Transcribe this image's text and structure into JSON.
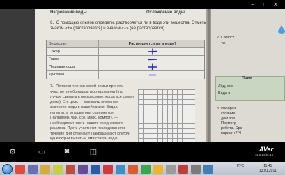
{
  "window": {
    "minimize_glyph": "−",
    "maximize_glyph": "□",
    "close_glyph": "✕"
  },
  "book_left": {
    "header_left": "Нагревание воды",
    "header_right": "Охлаждение воды",
    "task6_number": "6.",
    "task6_text": "С помощью опытов определи, растворяется ли в во­де эти вещества. Отметь знаком «+» (растворяется) и знаком «−» (не растворяется).",
    "table": {
      "col1": "Вещество",
      "col2": "Растворяется ли в воде?",
      "rows": [
        {
          "substance": "Сахар",
          "mark": "+"
        },
        {
          "substance": "Глина",
          "mark": "−"
        },
        {
          "substance": "Пищевая сода",
          "mark": "+"
        },
        {
          "substance": "Крахмал",
          "mark": "−"
        }
      ]
    },
    "task7_number": "7.",
    "task7_text": "Попроси членов своей семьи принять участие в небольшом исследовании (это лучше сделать в воскресенье, когда все семья дома). Его цель — осознать огром­ное значение воды в нашей жизни. Вода и напитки, в которых она со­держится (например, чай, сок, морс, ком­пот), — необходимая часть нашего еже­дневного рациона. Пусть участники исследования в тече­ние дня отмечают (закрашивают клеточ­ку) каждый выпитый ими стакан воды. ...количество ..."
  },
  "book_right": {
    "item2": "2. Самост",
    "item2b": "ты",
    "box_label_1": "Прим",
    "box_label_2": "Лёд, сне",
    "box_label_3": "Вода в",
    "item3": "3. Изобраз",
    "item3_lines": [
      "стояние",
      "дом зов",
      "Посмотр",
      "ребята. Сра",
      "вариант? Ч"
    ]
  },
  "toolbar": {
    "settings_glyph": "⚙",
    "crop_glyph": "▭",
    "record_glyph": "◙",
    "photo_glyph": "◫",
    "brand": "AVer",
    "brand_sub": "11.0.2040.44"
  },
  "taskbar": {
    "language": "РУС",
    "time": "11:41",
    "date": "13.01.2011"
  },
  "colors": {
    "page": "#e9e6df",
    "ink_blue": "#1f2bd6",
    "taskbar": "#c4cbd5"
  }
}
